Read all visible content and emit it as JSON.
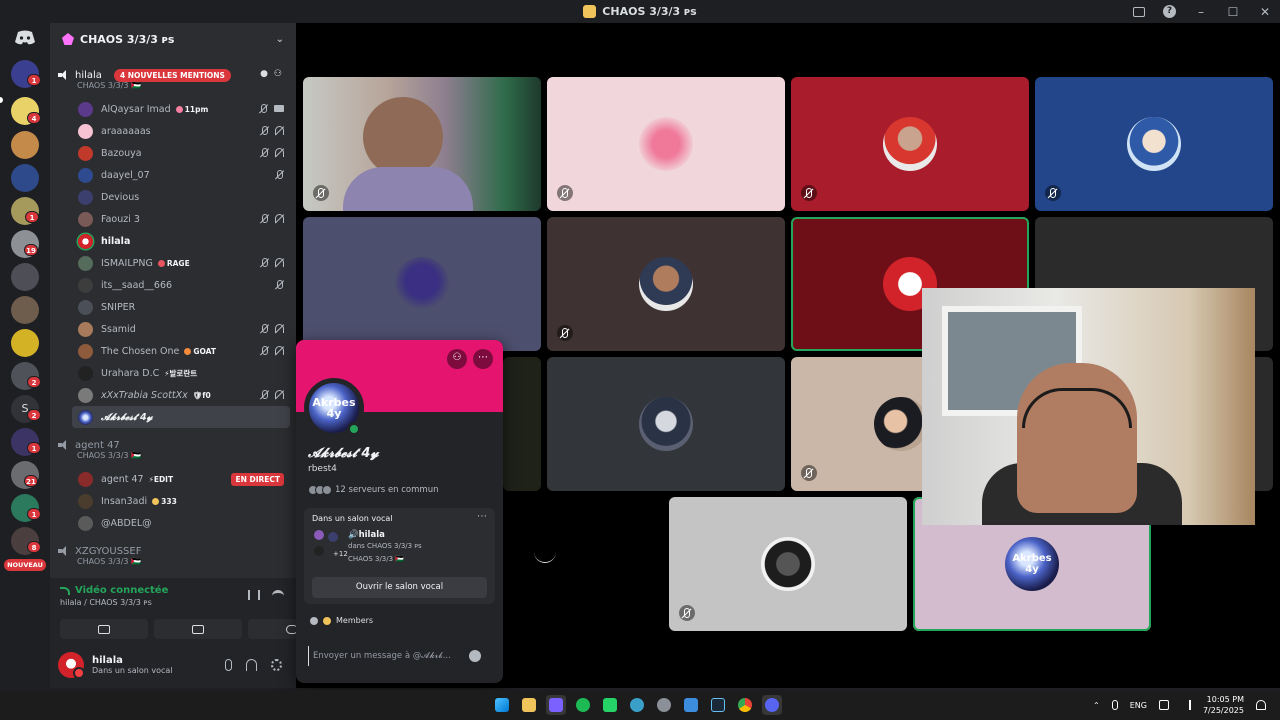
{
  "window": {
    "title": "CHAOS 3/3/3 ᴘs"
  },
  "rail": {
    "badges": [
      {
        "id": "b1",
        "count": "1"
      },
      {
        "id": "b2",
        "count": "4"
      },
      {
        "id": "b3",
        "count": "1"
      },
      {
        "id": "b4",
        "count": "19"
      },
      {
        "id": "b5",
        "count": "2"
      },
      {
        "id": "b6",
        "count": "2"
      },
      {
        "id": "b7",
        "count": "1"
      },
      {
        "id": "b8",
        "count": "21"
      },
      {
        "id": "b9",
        "count": "1"
      },
      {
        "id": "b10",
        "count": "8"
      }
    ],
    "letter_server": "S",
    "new_label": "NOUVEAU"
  },
  "server": {
    "name": "CHAOS 3/3/3 ᴘs"
  },
  "voice_channels": [
    {
      "name": "hilala",
      "mention_label": "4 NOUVELLES MENTIONS",
      "subtitle": "CHAOS 3/3/3 🇵🇸",
      "members": [
        {
          "name": "AlQaysar Imad",
          "tag": "11pm"
        },
        {
          "name": "araaaaaas",
          "tag": ""
        },
        {
          "name": "Bazouya",
          "tag": ""
        },
        {
          "name": "daayel_07",
          "tag": ""
        },
        {
          "name": "Devious",
          "tag": ""
        },
        {
          "name": "Faouzi 3",
          "tag": ""
        },
        {
          "name": "hilala",
          "tag": ""
        },
        {
          "name": "ISMAILPNG",
          "tag": "RAGE"
        },
        {
          "name": "its__saad__666",
          "tag": ""
        },
        {
          "name": "SNIPER",
          "tag": ""
        },
        {
          "name": "Ssamid",
          "tag": ""
        },
        {
          "name": "The Chosen One",
          "tag": "GOAT"
        },
        {
          "name": "Urahara D.C",
          "tag": "⚡발로란트"
        },
        {
          "name": "xXxTrabia ScottXx",
          "tag": "🛡f0"
        },
        {
          "name": "𝓐𝓴𝓻𝓫𝓮𝓼𝓽 4𝔂",
          "tag": ""
        }
      ]
    },
    {
      "name": "agent 47",
      "subtitle": "CHAOS 3/3/3 🇵🇸",
      "live_label": "EN DIRECT",
      "members": [
        {
          "name": "agent 47",
          "tag": "⚡EDIT"
        },
        {
          "name": "Insan3adi",
          "tag": "333"
        },
        {
          "name": "@ABDEL@",
          "tag": ""
        }
      ]
    },
    {
      "name": "XZGYOUSSEF",
      "subtitle": "CHAOS 3/3/3 🇵🇸"
    }
  ],
  "voice_panel": {
    "status": "Vidéo connectée",
    "location": "hilala / CHAOS 3/3/3 ᴘs"
  },
  "user_panel": {
    "name": "hilala",
    "status": "Dans un salon vocal"
  },
  "profile": {
    "avatar_text_1": "Akrbes",
    "avatar_text_2": "4y",
    "display_name": "𝓐𝓴𝓻𝓫𝓮𝓼𝓽 4𝔂",
    "username": "rbest4",
    "mutual": "12 serveurs en commun",
    "voice_card": {
      "title": "Dans un salon vocal",
      "channel": "🔊hilala",
      "server": "dans CHAOS 3/3/3 ᴘs",
      "server2": "CHAOS 3/3/3 🇵🇸",
      "extra": "+12",
      "open_button": "Ouvrir le salon vocal"
    },
    "roles_label": "Members",
    "message_placeholder": "Envoyer un message à @𝓐𝓴𝓻𝓫..."
  },
  "stage": {
    "pip_label": "",
    "tile_avatar_text_1": "Akrbes",
    "tile_avatar_text_2": "4y"
  },
  "taskbar": {
    "lang": "ENG",
    "time": "10:05 PM",
    "date": "7/25/2025"
  },
  "colors": {
    "accent": "#5865f2",
    "danger": "#da373c",
    "online": "#23a55a",
    "banner": "#e5156f"
  }
}
